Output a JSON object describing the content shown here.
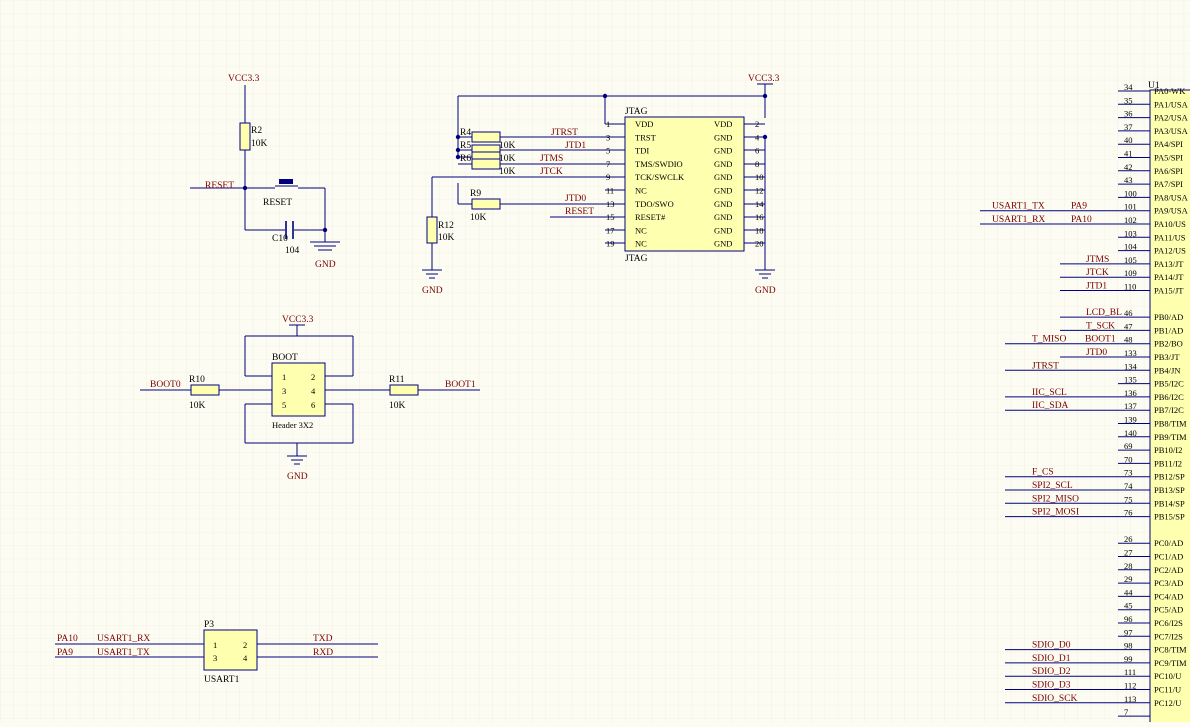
{
  "colors": {
    "background": "#fdfcf2",
    "wire": "#000080",
    "component": "#ffffb0",
    "netlabel": "#7a0000",
    "grid": "#ece9de"
  },
  "power": {
    "vcc": "VCC3.3",
    "gnd": "GND"
  },
  "reset_circuit": {
    "r2": "R2",
    "r2_val": "10K",
    "net": "RESET",
    "button": "RESET",
    "c10": "C10",
    "c10_val": "104"
  },
  "jtag": {
    "title": "JTAG",
    "footer": "JTAG",
    "pins_left": [
      {
        "num": "1",
        "name": "VDD"
      },
      {
        "num": "3",
        "name": "TRST"
      },
      {
        "num": "5",
        "name": "TDI"
      },
      {
        "num": "7",
        "name": "TMS/SWDIO"
      },
      {
        "num": "9",
        "name": "TCK/SWCLK"
      },
      {
        "num": "11",
        "name": "NC"
      },
      {
        "num": "13",
        "name": "TDO/SWO"
      },
      {
        "num": "15",
        "name": "RESET#"
      },
      {
        "num": "17",
        "name": "NC"
      },
      {
        "num": "19",
        "name": "NC"
      }
    ],
    "pins_right": [
      {
        "num": "2",
        "name": "VDD"
      },
      {
        "num": "4",
        "name": "GND"
      },
      {
        "num": "6",
        "name": "GND"
      },
      {
        "num": "8",
        "name": "GND"
      },
      {
        "num": "10",
        "name": "GND"
      },
      {
        "num": "12",
        "name": "GND"
      },
      {
        "num": "14",
        "name": "GND"
      },
      {
        "num": "16",
        "name": "GND"
      },
      {
        "num": "18",
        "name": "GND"
      },
      {
        "num": "20",
        "name": "GND"
      }
    ],
    "resistors": [
      {
        "ref": "R4",
        "net": "JTRST"
      },
      {
        "ref": "R5",
        "val": "10K",
        "net": "JTD1"
      },
      {
        "ref": "R6",
        "val": "10K",
        "net": "JTMS"
      },
      {
        "ref": "",
        "val": "10K",
        "net": "JTCK"
      }
    ],
    "r9": "R9",
    "r9_val": "10K",
    "r9_net": "JTD0",
    "reset_net": "RESET",
    "r12": "R12",
    "r12_val": "10K"
  },
  "boot": {
    "ref": "BOOT",
    "footer": "Header 3X2",
    "pins": [
      "1",
      "2",
      "3",
      "4",
      "5",
      "6"
    ],
    "r10": "R10",
    "r10_val": "10K",
    "net_left": "BOOT0",
    "r11": "R11",
    "r11_val": "10K",
    "net_right": "BOOT1"
  },
  "usart": {
    "ref": "P3",
    "footer": "USART1",
    "pins": [
      "1",
      "2",
      "3",
      "4"
    ],
    "left_rows": [
      {
        "port": "PA10",
        "net": "USART1_RX"
      },
      {
        "port": "PA9",
        "net": "USART1_TX"
      }
    ],
    "right_nets": [
      "TXD",
      "RXD"
    ]
  },
  "mcu": {
    "ref": "U1",
    "pins": [
      {
        "num": "34",
        "name": "PA0-WK",
        "net": "",
        "port": ""
      },
      {
        "num": "35",
        "name": "PA1/USA",
        "net": "",
        "port": ""
      },
      {
        "num": "36",
        "name": "PA2/USA",
        "net": "",
        "port": ""
      },
      {
        "num": "37",
        "name": "PA3/USA",
        "net": "",
        "port": ""
      },
      {
        "num": "40",
        "name": "PA4/SPI",
        "net": "",
        "port": ""
      },
      {
        "num": "41",
        "name": "PA5/SPI",
        "net": "",
        "port": ""
      },
      {
        "num": "42",
        "name": "PA6/SPI",
        "net": "",
        "port": ""
      },
      {
        "num": "43",
        "name": "PA7/SPI",
        "net": "",
        "port": ""
      },
      {
        "num": "100",
        "name": "PA8/USA",
        "net": "",
        "port": ""
      },
      {
        "num": "101",
        "name": "PA9/USA",
        "net": "USART1_TX",
        "port": "PA9"
      },
      {
        "num": "102",
        "name": "PA10/US",
        "net": "USART1_RX",
        "port": "PA10"
      },
      {
        "num": "103",
        "name": "PA11/US",
        "net": "",
        "port": ""
      },
      {
        "num": "104",
        "name": "PA12/US",
        "net": "",
        "port": ""
      },
      {
        "num": "105",
        "name": "PA13/JT",
        "net": "JTMS",
        "port": ""
      },
      {
        "num": "109",
        "name": "PA14/JT",
        "net": "JTCK",
        "port": ""
      },
      {
        "num": "110",
        "name": "PA15/JT",
        "net": "JTD1",
        "port": ""
      },
      {
        "num": "46",
        "name": "PB0/AD",
        "net": "LCD_BL",
        "port": ""
      },
      {
        "num": "47",
        "name": "PB1/AD",
        "net": "T_SCK",
        "port": ""
      },
      {
        "num": "48",
        "name": "PB2/BO",
        "net": "T_MISO",
        "port": "BOOT1"
      },
      {
        "num": "133",
        "name": "PB3/JT",
        "net": "JTD0",
        "port": ""
      },
      {
        "num": "134",
        "name": "PB4/JN",
        "net": "JTRST",
        "port": ""
      },
      {
        "num": "135",
        "name": "PB5/I2C",
        "net": "",
        "port": ""
      },
      {
        "num": "136",
        "name": "PB6/I2C",
        "net": "IIC_SCL",
        "port": ""
      },
      {
        "num": "137",
        "name": "PB7/I2C",
        "net": "IIC_SDA",
        "port": ""
      },
      {
        "num": "139",
        "name": "PB8/TIM",
        "net": "",
        "port": ""
      },
      {
        "num": "140",
        "name": "PB9/TIM",
        "net": "",
        "port": ""
      },
      {
        "num": "69",
        "name": "PB10/I2",
        "net": "",
        "port": ""
      },
      {
        "num": "70",
        "name": "PB11/I2",
        "net": "",
        "port": ""
      },
      {
        "num": "73",
        "name": "PB12/SP",
        "net": "F_CS",
        "port": ""
      },
      {
        "num": "74",
        "name": "PB13/SP",
        "net": "SPI2_SCL",
        "port": ""
      },
      {
        "num": "75",
        "name": "PB14/SP",
        "net": "SPI2_MISO",
        "port": ""
      },
      {
        "num": "76",
        "name": "PB15/SP",
        "net": "SPI2_MOSI",
        "port": ""
      },
      {
        "num": "26",
        "name": "PC0/AD",
        "net": "",
        "port": ""
      },
      {
        "num": "27",
        "name": "PC1/AD",
        "net": "",
        "port": ""
      },
      {
        "num": "28",
        "name": "PC2/AD",
        "net": "",
        "port": ""
      },
      {
        "num": "29",
        "name": "PC3/AD",
        "net": "",
        "port": ""
      },
      {
        "num": "44",
        "name": "PC4/AD",
        "net": "",
        "port": ""
      },
      {
        "num": "45",
        "name": "PC5/AD",
        "net": "",
        "port": ""
      },
      {
        "num": "96",
        "name": "PC6/I2S",
        "net": "",
        "port": ""
      },
      {
        "num": "97",
        "name": "PC7/I2S",
        "net": "",
        "port": ""
      },
      {
        "num": "98",
        "name": "PC8/TIM",
        "net": "SDIO_D0",
        "port": ""
      },
      {
        "num": "99",
        "name": "PC9/TIM",
        "net": "SDIO_D1",
        "port": ""
      },
      {
        "num": "111",
        "name": "PC10/U",
        "net": "SDIO_D2",
        "port": ""
      },
      {
        "num": "112",
        "name": "PC11/U",
        "net": "SDIO_D3",
        "port": ""
      },
      {
        "num": "113",
        "name": "PC12/U",
        "net": "SDIO_SCK",
        "port": ""
      },
      {
        "num": "7",
        "name": "",
        "net": "",
        "port": ""
      }
    ]
  }
}
